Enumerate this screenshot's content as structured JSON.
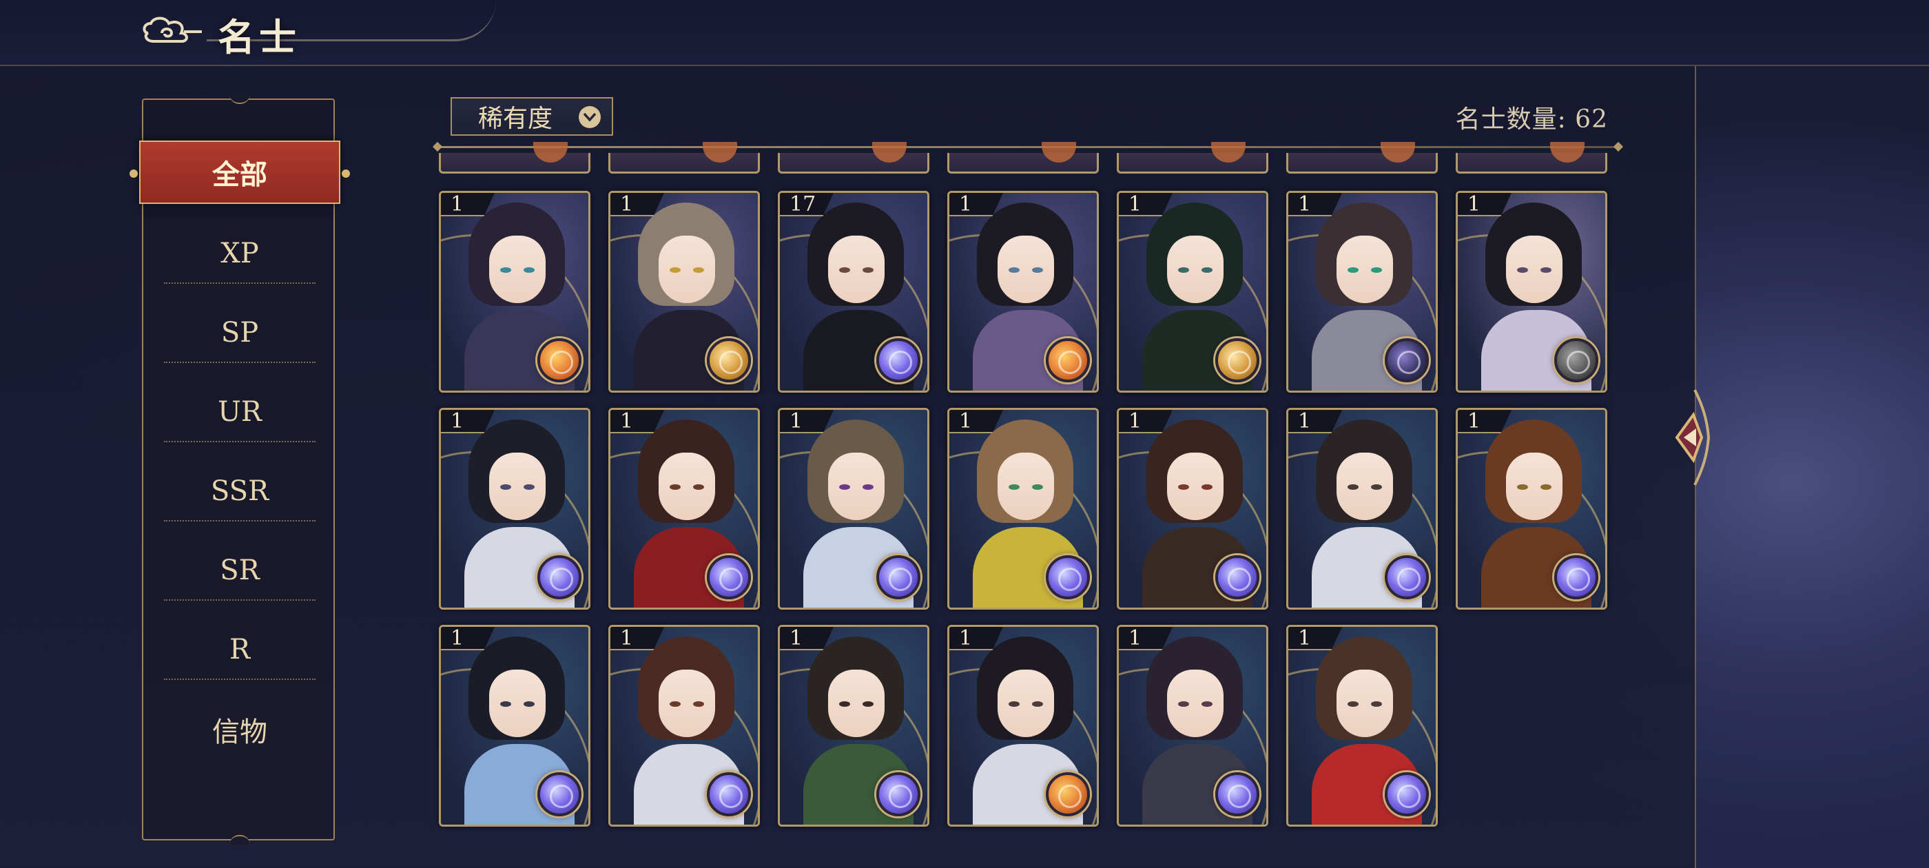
{
  "header": {
    "title": "名士",
    "logo_icon": "cloud-swirl-icon"
  },
  "sidebar": {
    "items": [
      {
        "label": "全部",
        "active": true
      },
      {
        "label": "XP"
      },
      {
        "label": "SP"
      },
      {
        "label": "UR"
      },
      {
        "label": "SSR"
      },
      {
        "label": "SR"
      },
      {
        "label": "R"
      },
      {
        "label": "信物"
      }
    ]
  },
  "toolbar": {
    "sort_label": "稀有度",
    "sort_icon": "chevron-down-icon",
    "count_label": "名士数量: 62"
  },
  "cards": [
    {
      "level": "1",
      "element": "fire",
      "hair": "#2a2236",
      "eyes": "#3a8a9a",
      "outfit": "#3a3658",
      "bg": "#4a4a7a"
    },
    {
      "level": "1",
      "element": "gold",
      "hair": "#8c7e70",
      "eyes": "#c59a3a",
      "outfit": "#222030",
      "bg": "#4a4a7a"
    },
    {
      "level": "17",
      "element": "blue",
      "hair": "#1c1a22",
      "eyes": "#6a4a3a",
      "outfit": "#1a1a22",
      "bg": "#3e4270"
    },
    {
      "level": "1",
      "element": "fire",
      "hair": "#1c1a22",
      "eyes": "#5a7a9a",
      "outfit": "#6a5a8a",
      "bg": "#4a4a7a"
    },
    {
      "level": "1",
      "element": "gold",
      "hair": "#1a2824",
      "eyes": "#3a6a6a",
      "outfit": "#1e2a24",
      "bg": "#3e4270"
    },
    {
      "level": "1",
      "element": "dark",
      "hair": "#3a3034",
      "eyes": "#2a9a7a",
      "outfit": "#8a8a9a",
      "bg": "#4a4a7a"
    },
    {
      "level": "1",
      "element": "gray",
      "hair": "#1c1a22",
      "eyes": "#5a4a6a",
      "outfit": "#c8c0d8",
      "bg": "#6a6490"
    },
    {
      "level": "1",
      "element": "blue",
      "hair": "#1e1e2a",
      "eyes": "#4a4a6a",
      "outfit": "#d8d8e4",
      "bg": "#2e4868"
    },
    {
      "level": "1",
      "element": "blue",
      "hair": "#3a2220",
      "eyes": "#6a3a2a",
      "outfit": "#8a1e22",
      "bg": "#2e4868"
    },
    {
      "level": "1",
      "element": "blue",
      "hair": "#6a5a4a",
      "eyes": "#6a3a8a",
      "outfit": "#c8d0e4",
      "bg": "#2e4868"
    },
    {
      "level": "1",
      "element": "blue",
      "hair": "#8a6a4a",
      "eyes": "#3a8a5a",
      "outfit": "#c8b43a",
      "bg": "#2e4868"
    },
    {
      "level": "1",
      "element": "blue",
      "hair": "#3a2420",
      "eyes": "#7a3a2a",
      "outfit": "#3a2a24",
      "bg": "#2e4868"
    },
    {
      "level": "1",
      "element": "blue",
      "hair": "#2a2426",
      "eyes": "#4a3a3a",
      "outfit": "#d8d8e4",
      "bg": "#2e4868"
    },
    {
      "level": "1",
      "element": "blue",
      "hair": "#6a3a22",
      "eyes": "#8a6a2a",
      "outfit": "#6a3a22",
      "bg": "#2e4868"
    },
    {
      "level": "1",
      "element": "blue",
      "hair": "#1a1c28",
      "eyes": "#3a3a4a",
      "outfit": "#8aaad8",
      "bg": "#2e4868"
    },
    {
      "level": "1",
      "element": "blue",
      "hair": "#4a2a22",
      "eyes": "#6a3a2a",
      "outfit": "#d8d8e4",
      "bg": "#2e4868"
    },
    {
      "level": "1",
      "element": "blue",
      "hair": "#2a2422",
      "eyes": "#3a2a2a",
      "outfit": "#3a5a3a",
      "bg": "#2e4868"
    },
    {
      "level": "1",
      "element": "fire",
      "hair": "#1e1a22",
      "eyes": "#4a3a3a",
      "outfit": "#d8d8e4",
      "bg": "#2e4868"
    },
    {
      "level": "1",
      "element": "blue",
      "hair": "#2a2230",
      "eyes": "#5a3a4a",
      "outfit": "#3a3a4a",
      "bg": "#2e4868"
    },
    {
      "level": "1",
      "element": "blue",
      "hair": "#4a3228",
      "eyes": "#4a3a3a",
      "outfit": "#b82a2a",
      "bg": "#2e4868"
    }
  ],
  "side_arrow_icon": "chevron-right-icon"
}
